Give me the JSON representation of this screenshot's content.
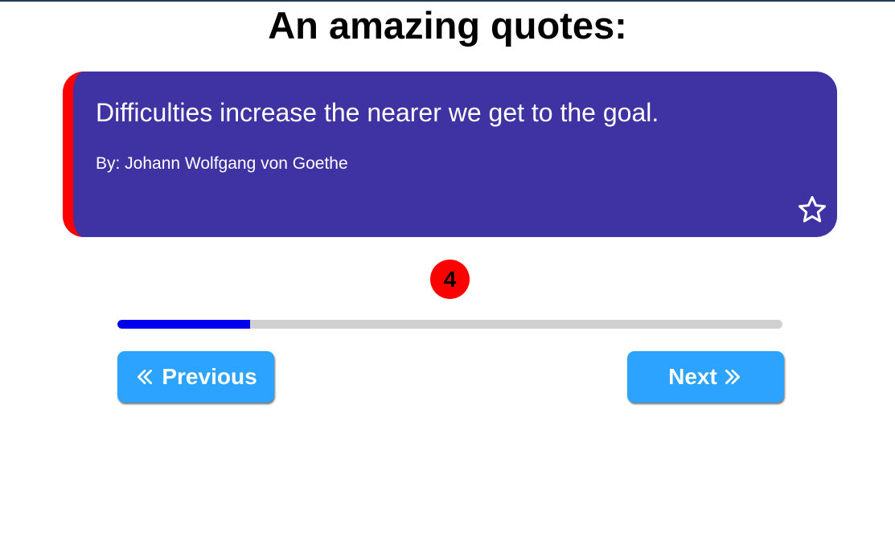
{
  "page": {
    "title": "An amazing quotes:"
  },
  "quote": {
    "text": "Difficulties increase the nearer we get to the goal.",
    "author": "By: Johann Wolfgang von Goethe",
    "favorite_icon": "star-outline-icon"
  },
  "counter": {
    "value": "4"
  },
  "progress": {
    "fraction": 0.2
  },
  "navigation": {
    "previous_label": "Previous",
    "previous_icon": "double-chevron-left-icon",
    "next_label": "Next",
    "next_icon": "double-chevron-right-icon"
  },
  "colors": {
    "card_background": "#3f32a3",
    "card_accent": "#ff0000",
    "badge": "#ff0000",
    "progress_fill": "#0000ee",
    "button": "#2ba3ff"
  }
}
